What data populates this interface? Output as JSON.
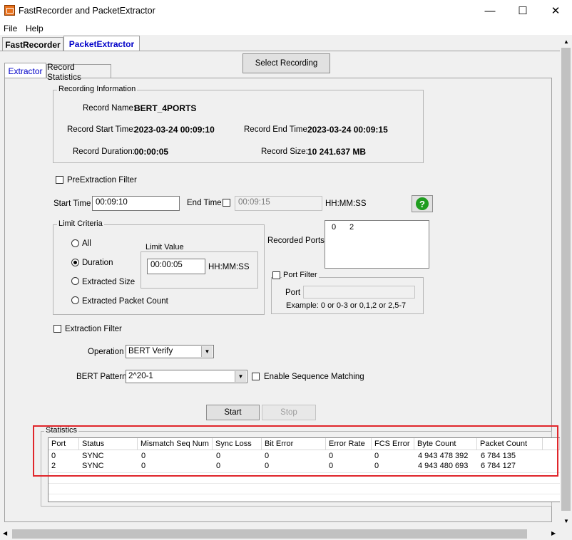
{
  "window": {
    "title": "FastRecorder and PacketExtractor",
    "minimize": "—",
    "maximize": "☐",
    "close": "✕"
  },
  "menu": {
    "file": "File",
    "help": "Help"
  },
  "main_tabs": [
    "FastRecorder",
    "PacketExtractor"
  ],
  "sub_tabs": [
    "Extractor",
    "Record Statistics"
  ],
  "select_recording_label": "Select Recording",
  "recording_info": {
    "title": "Recording Information",
    "name_label": "Record Name:",
    "name": "BERT_4PORTS",
    "start_label": "Record Start Time:",
    "start": "2023-03-24 00:09:10",
    "end_label": "Record End Time:",
    "end": "2023-03-24 00:09:15",
    "duration_label": "Record Duration:",
    "duration": "00:00:05",
    "size_label": "Record Size:",
    "size": "10 241.637 MB"
  },
  "pre_filter_label": "PreExtraction Filter",
  "start_time_label": "Start Time",
  "start_time_value": "00:09:10",
  "end_time_label": "End Time",
  "end_time_value": "00:09:15",
  "time_format": "HH:MM:SS",
  "limit": {
    "title": "Limit Criteria",
    "options": [
      "All",
      "Duration",
      "Extracted Size",
      "Extracted Packet Count"
    ],
    "selected": "Duration",
    "value_title": "Limit Value",
    "value": "00:00:05",
    "format": "HH:MM:SS"
  },
  "recorded_ports_label": "Recorded Ports:",
  "recorded_ports": [
    "0",
    "2"
  ],
  "port_filter": {
    "label": "Port Filter",
    "port_label": "Port",
    "example": "Example: 0 or 0-3 or 0,1,2 or 2,5-7"
  },
  "extraction_filter_label": "Extraction Filter",
  "operation_label": "Operation",
  "operation_value": "BERT Verify",
  "bert_pattern_label": "BERT Pattern",
  "bert_pattern_value": "2^20-1",
  "enable_seq_label": "Enable Sequence Matching",
  "start_button": "Start",
  "stop_button": "Stop",
  "statistics": {
    "title": "Statistics",
    "columns": [
      "Port",
      "Status",
      "Mismatch Seq Num",
      "Sync Loss",
      "Bit Error",
      "Error Rate",
      "FCS Error",
      "Byte Count",
      "Packet Count"
    ],
    "rows": [
      [
        "0",
        "SYNC",
        "0",
        "0",
        "0",
        "0",
        "0",
        "4 943 478 392",
        "6 784 135"
      ],
      [
        "2",
        "SYNC",
        "0",
        "0",
        "0",
        "0",
        "0",
        "4 943 480 693",
        "6 784 127"
      ]
    ]
  },
  "colors": {
    "highlight": "#e0262b",
    "help_icon": "#1f9d1f",
    "active_tab_text": "#0000c8"
  }
}
